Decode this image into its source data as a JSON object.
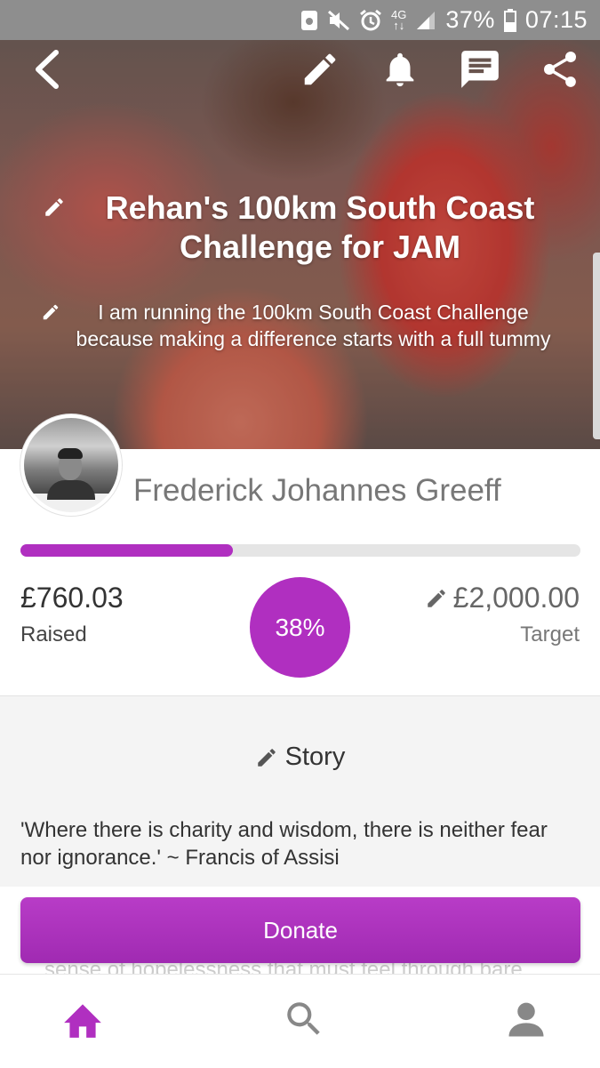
{
  "status_bar": {
    "network": "4G",
    "battery_percent": "37%",
    "time": "07:15",
    "icons": [
      "storage-icon",
      "mute-icon",
      "alarm-icon",
      "network-4g-icon",
      "signal-icon",
      "battery-icon"
    ]
  },
  "toolbar": {
    "icons": [
      "back-icon",
      "edit-icon",
      "notification-bell-icon",
      "message-icon",
      "share-icon"
    ]
  },
  "hero": {
    "title": "Rehan's 100km South Coast Challenge for JAM",
    "subtitle": "I am running the 100km South Coast Challenge because making a difference starts with a full tummy"
  },
  "profile": {
    "name": "Frederick Johannes Greeff"
  },
  "fundraising": {
    "raised_amount": "£760.03",
    "raised_label": "Raised",
    "percent_label": "38%",
    "progress_fraction": 0.38,
    "target_amount": "£2,000.00",
    "target_label": "Target"
  },
  "story": {
    "heading": "Story",
    "quote": "'Where there is charity and wisdom, there is neither fear nor ignorance.' ~ Francis of Assisi",
    "overflow_text": "sense of hopelessness that must feel through bare"
  },
  "actions": {
    "donate_label": "Donate"
  },
  "bottom_nav": {
    "items": [
      "home-icon",
      "search-icon",
      "profile-icon"
    ]
  },
  "colors": {
    "accent": "#b02fc0",
    "status_bar": "#8e8e8e",
    "progress_track": "#e5e5e5"
  }
}
